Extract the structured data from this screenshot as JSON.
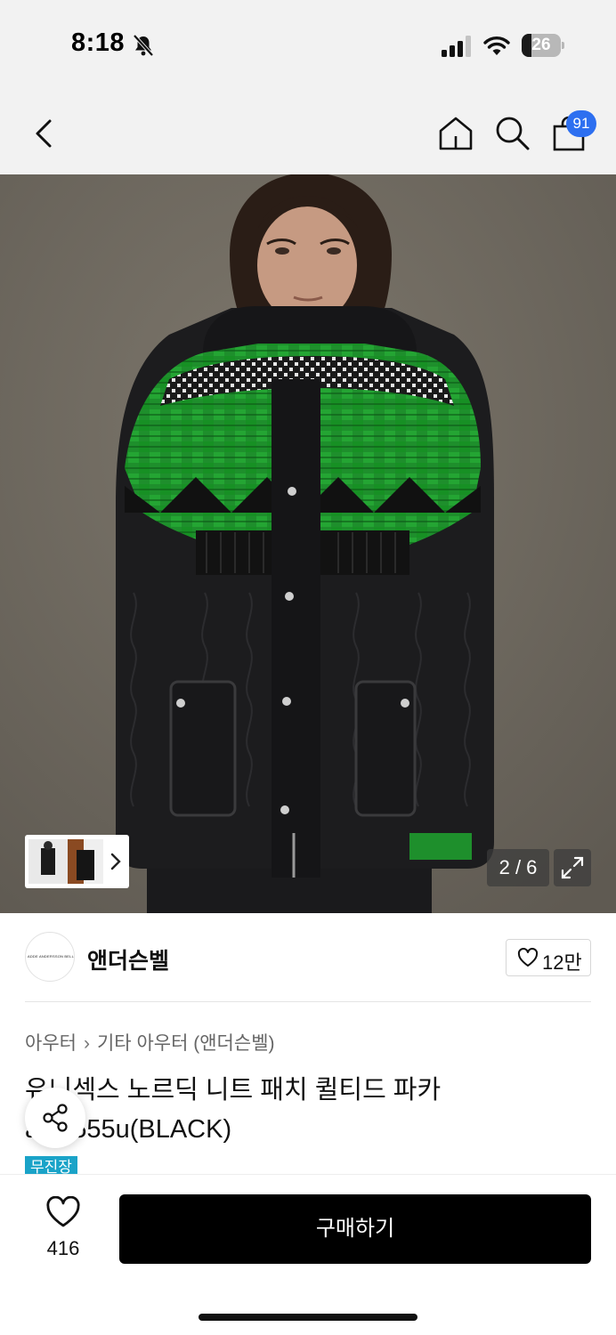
{
  "status_bar": {
    "time": "8:18",
    "battery_level": "26",
    "battery_fraction": 0.26
  },
  "nav": {
    "cart_count": "91"
  },
  "hero": {
    "page_indicator": "2 / 6"
  },
  "brand": {
    "logo_text": "ADDE ANDERSSON BELL",
    "name": "앤더슨벨",
    "likes": "12만"
  },
  "breadcrumb": {
    "category": "아우터",
    "separator": "›",
    "subcategory": "기타 아우터 (앤더슨벨)"
  },
  "product": {
    "title": "유니섹스 노르딕 니트 패치 퀼티드 파카 awa555u(BLACK)",
    "tag": "무진장"
  },
  "bottom_bar": {
    "wish_count": "416",
    "buy_label": "구매하기"
  },
  "colors": {
    "badge_blue": "#2d6ff0",
    "tag_teal": "#1aa3c8",
    "buy_black": "#000000"
  },
  "icons": [
    "bell-slash-icon",
    "signal-icon",
    "wifi-icon",
    "back-arrow-icon",
    "home-icon",
    "search-icon",
    "shopping-bag-icon",
    "chevron-right-icon",
    "expand-icon",
    "heart-icon",
    "share-icon"
  ]
}
